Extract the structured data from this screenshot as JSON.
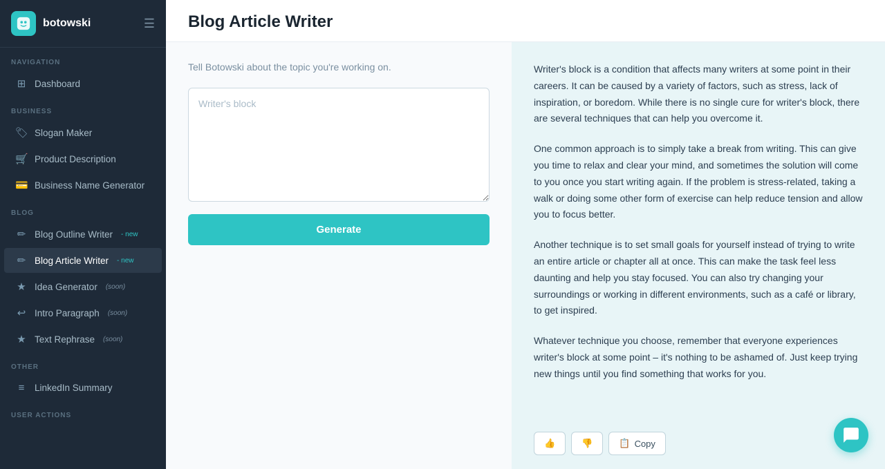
{
  "sidebar": {
    "logo": {
      "icon": "🤖",
      "text": "botowski"
    },
    "sections": [
      {
        "label": "NAVIGATION",
        "items": [
          {
            "id": "dashboard",
            "label": "Dashboard",
            "icon": "⊞"
          }
        ]
      },
      {
        "label": "BUSINESS",
        "items": [
          {
            "id": "slogan-maker",
            "label": "Slogan Maker",
            "icon": "🏷"
          },
          {
            "id": "product-description",
            "label": "Product Description",
            "icon": "🛒"
          },
          {
            "id": "business-name-generator",
            "label": "Business Name Generator",
            "icon": "💳"
          }
        ]
      },
      {
        "label": "BLOG",
        "items": [
          {
            "id": "blog-outline-writer",
            "label": "Blog Outline Writer",
            "badge": "new",
            "icon": "✏"
          },
          {
            "id": "blog-article-writer",
            "label": "Blog Article Writer",
            "badge": "new",
            "icon": "✏",
            "active": true
          },
          {
            "id": "idea-generator",
            "label": "Idea Generator",
            "badge": "soon",
            "icon": "★"
          },
          {
            "id": "intro-paragraph",
            "label": "Intro Paragraph",
            "badge": "soon",
            "icon": "↩"
          },
          {
            "id": "text-rephrase",
            "label": "Text Rephrase",
            "badge": "soon",
            "icon": "★"
          }
        ]
      },
      {
        "label": "OTHER",
        "items": [
          {
            "id": "linkedin-summary",
            "label": "LinkedIn Summary",
            "icon": "≡"
          }
        ]
      },
      {
        "label": "USER ACTIONS",
        "items": []
      }
    ]
  },
  "main": {
    "title": "Blog Article Writer",
    "subtitle": "Tell Botowski about the topic you're working on.",
    "textarea_placeholder": "Writer's block",
    "generate_label": "Generate",
    "output": {
      "paragraphs": [
        "Writer's block is a condition that affects many writers at some point in their careers. It can be caused by a variety of factors, such as stress, lack of inspiration, or boredom. While there is no single cure for writer's block, there are several techniques that can help you overcome it.",
        "One common approach is to simply take a break from writing. This can give you time to relax and clear your mind, and sometimes the solution will come to you once you start writing again. If the problem is stress-related, taking a walk or doing some other form of exercise can help reduce tension and allow you to focus better.",
        "Another technique is to set small goals for yourself instead of trying to write an entire article or chapter all at once. This can make the task feel less daunting and help you stay focused. You can also try changing your surroundings or working in different environments, such as a café or library, to get inspired.",
        "Whatever technique you choose, remember that everyone experiences writer's block at some point – it's nothing to be ashamed of. Just keep trying new things until you find something that works for you."
      ],
      "actions": {
        "thumbs_up": "👍",
        "thumbs_down": "👎",
        "copy_icon": "📋",
        "copy_label": "Copy"
      }
    }
  }
}
